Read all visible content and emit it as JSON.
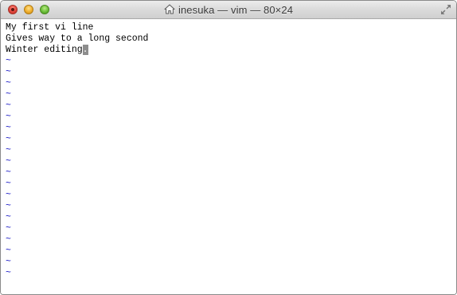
{
  "window": {
    "title": "inesuka — vim — 80×24",
    "home_icon": "house-icon",
    "resize_icon": "fullscreen-arrows-icon",
    "controls": {
      "close": "close-button",
      "minimize": "minimize-button",
      "zoom": "zoom-button"
    }
  },
  "editor": {
    "lines": [
      "My first vi line",
      "Gives way to a long second",
      "Winter editing"
    ],
    "cursor_char": ".",
    "empty_line_marker": "~",
    "colors": {
      "tilde": "#2020c8",
      "cursor_bg": "#8d8d8d",
      "text": "#000000"
    }
  }
}
